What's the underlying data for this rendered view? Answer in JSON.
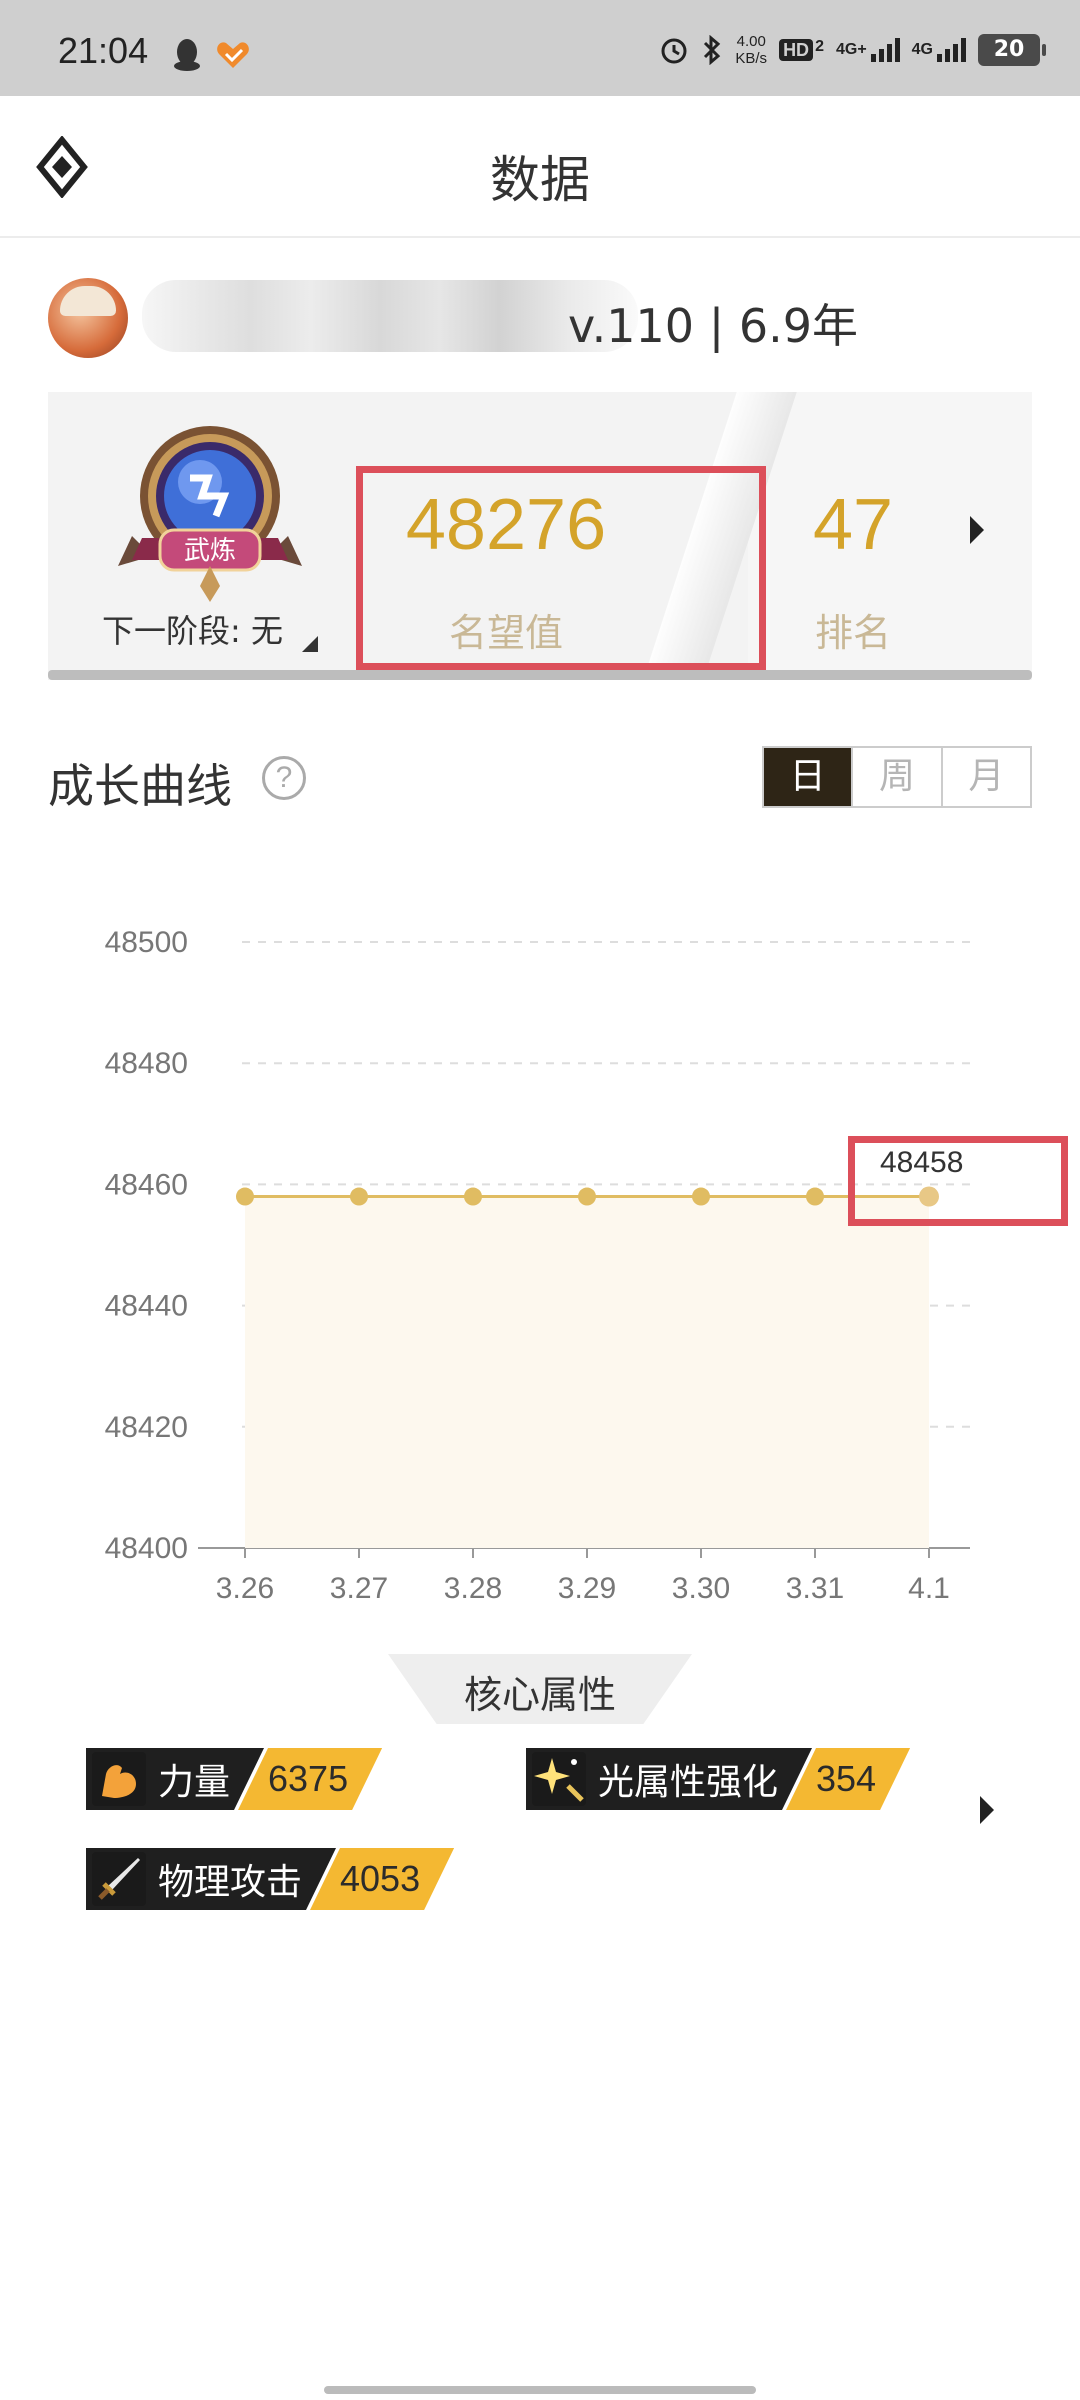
{
  "status_bar": {
    "time": "21:04",
    "net_speed_value": "4.00",
    "net_speed_unit": "KB/s",
    "hd_label": "HD",
    "hd_sub": "2",
    "sim1_label": "4G+",
    "sim2_label": "4G",
    "battery": "20",
    "icons": [
      "qq-icon",
      "heart-app-icon",
      "alarm-icon",
      "bluetooth-icon",
      "signal-icon",
      "battery-icon"
    ]
  },
  "header": {
    "title": "数据",
    "logo_icon": "diamond-logo-icon"
  },
  "profile": {
    "level_text": "v.110 | 6.9年"
  },
  "reputation_card": {
    "badge_text": "武炼",
    "next_stage": "下一阶段: 无",
    "reputation_value": "48276",
    "reputation_label": "名望值",
    "rank_value": "47",
    "rank_label": "排名"
  },
  "growth": {
    "title": "成长曲线",
    "help_symbol": "?",
    "periods": [
      "日",
      "周",
      "月"
    ],
    "active_period": "日"
  },
  "chart_data": {
    "type": "area",
    "categories": [
      "3.26",
      "3.27",
      "3.28",
      "3.29",
      "3.30",
      "3.31",
      "4.1"
    ],
    "values": [
      48458,
      48458,
      48458,
      48458,
      48458,
      48458,
      48458
    ],
    "ylim": [
      48400,
      48500
    ],
    "yticks": [
      "48500",
      "48480",
      "48460",
      "48440",
      "48420",
      "48400"
    ],
    "last_value_label": "48458",
    "grid": true,
    "colors": {
      "line": "#e0bc62",
      "fill": "#fdf8ee",
      "grid": "#dddddd"
    }
  },
  "core_attributes": {
    "title": "核心属性",
    "items": [
      {
        "label": "力量",
        "value": "6375",
        "icon": "flexed-arm-icon"
      },
      {
        "label": "光属性强化",
        "value": "354",
        "icon": "light-sparkle-icon"
      },
      {
        "label": "物理攻击",
        "value": "4053",
        "icon": "sword-icon"
      }
    ]
  },
  "colors": {
    "accent_gold": "#d4a32a",
    "label_tan": "#c9b896",
    "highlight_red": "#dc4f5a",
    "attr_yellow": "#f4b832",
    "dark": "#2e2516"
  }
}
